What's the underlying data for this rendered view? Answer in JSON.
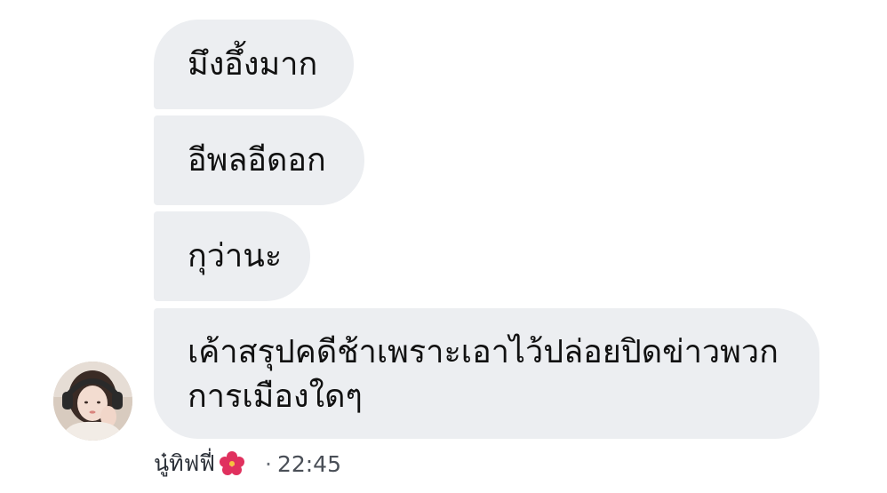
{
  "messages": [
    {
      "text": "มึงอึ้งมาก"
    },
    {
      "text": "อีพลอีดอก"
    },
    {
      "text": "กุว่านะ"
    },
    {
      "lines": [
        "เค้าสรุปคดีช้าเพราะเอาไว้ปล่อยปิดข่าวพวก",
        "การเมืองใดๆ"
      ]
    }
  ],
  "sender": {
    "name": "นู๋ทิฟฟี่",
    "emoji": "hibiscus-icon",
    "separator": "·",
    "time": "22:45"
  },
  "colors": {
    "bubble": "#eceef1",
    "text": "#111111",
    "meta": "#4a4f57"
  }
}
